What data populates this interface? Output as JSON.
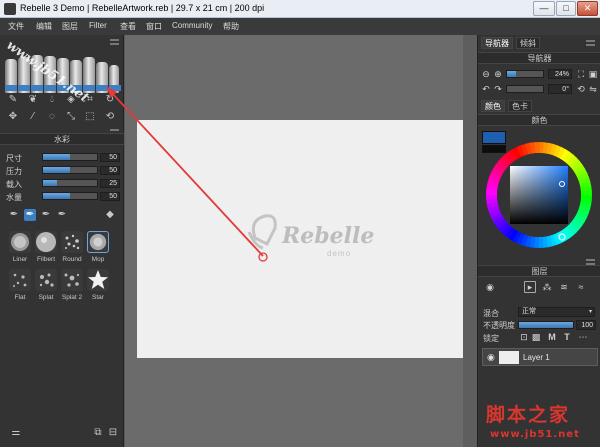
{
  "window": {
    "title": "Rebelle 3 Demo | RebelleArtwork.reb | 29.7 x 21 cm | 200 dpi",
    "min_label": "—",
    "max_label": "□",
    "close_label": "✕"
  },
  "menu": [
    "文件",
    "编辑",
    "图层",
    "Filter",
    "查看",
    "窗口",
    "Community",
    "帮助"
  ],
  "tubes": {
    "stripe_colors": [
      "#3f7fc0",
      "#3f7fc0",
      "#3f7fc0",
      "#3f7fc0",
      "#3f7fc0",
      "#3f7fc0",
      "#3f7fc0",
      "#3f7fc0",
      "#3f7fc0"
    ]
  },
  "brush_panel": {
    "title": "水彩",
    "sliders": [
      {
        "label": "尺寸",
        "value": "50",
        "level": 0.5
      },
      {
        "label": "压力",
        "value": "50",
        "level": 0.5
      },
      {
        "label": "载入",
        "value": "25",
        "level": 0.25
      },
      {
        "label": "水量",
        "value": "50",
        "level": 0.5
      }
    ],
    "brushes": [
      {
        "label": "Liner"
      },
      {
        "label": "Filbert"
      },
      {
        "label": "Round"
      },
      {
        "label": "Mop"
      },
      {
        "label": "Flat"
      },
      {
        "label": "Splat"
      },
      {
        "label": "Splat 2"
      },
      {
        "label": "Star"
      }
    ]
  },
  "navigator": {
    "tabs": [
      "导航器",
      "倾斜"
    ],
    "title": "导航器",
    "zoom": "24%",
    "zoom_level": 0.24,
    "rotation": "0°",
    "rotation_level": 0.0
  },
  "color_panel": {
    "tabs": [
      "颜色",
      "色卡"
    ],
    "title": "颜色",
    "current_color": "#1f5fb0"
  },
  "layers_panel": {
    "title": "图层",
    "blend_label": "混合",
    "blend_value": "正常",
    "opacity_label": "不透明度",
    "opacity_value": "100",
    "opacity_level": 1.0,
    "lock_label": "锁定",
    "lock_letters": [
      "M",
      "T"
    ],
    "layer_name": "Layer 1"
  },
  "canvas": {
    "logo_name": "Rebelle",
    "logo_sub": "demo"
  },
  "watermarks": {
    "diagonal": "www.jb51.net",
    "cn_text": "脚本之家",
    "url_text": "www.jb51.net"
  }
}
